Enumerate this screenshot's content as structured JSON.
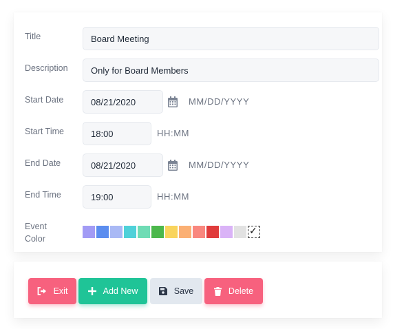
{
  "form": {
    "title": {
      "label": "Title",
      "value": "Board Meeting"
    },
    "description": {
      "label": "Description",
      "value": "Only for Board Members"
    },
    "start_date": {
      "label": "Start Date",
      "value": "08/21/2020",
      "hint": "MM/DD/YYYY",
      "icon": "calendar-icon"
    },
    "start_time": {
      "label": "Start Time",
      "value": "18:00",
      "hint": "HH:MM"
    },
    "end_date": {
      "label": "End Date",
      "value": "08/21/2020",
      "hint": "MM/DD/YYYY",
      "icon": "calendar-icon"
    },
    "end_time": {
      "label": "End Time",
      "value": "19:00",
      "hint": "HH:MM"
    },
    "event_color": {
      "label_line1": "Event",
      "label_line2": "Color",
      "colors": [
        "#a29bf5",
        "#5b8def",
        "#a9b9f5",
        "#4fd1d9",
        "#6fdcb5",
        "#4cb84c",
        "#f9d45c",
        "#fbb074",
        "#f9877e",
        "#e03c3c",
        "#dab3f7",
        "#e2e2e2",
        "#ffffff"
      ],
      "selected_index": 12,
      "selected_mark": "✓"
    }
  },
  "buttons": {
    "exit": {
      "label": "Exit",
      "icon": "sign-out-icon"
    },
    "add_new": {
      "label": "Add New",
      "icon": "plus-icon"
    },
    "save": {
      "label": "Save",
      "icon": "floppy-disk-icon"
    },
    "delete": {
      "label": "Delete",
      "icon": "trash-icon"
    }
  },
  "colors": {
    "danger": "#f7617e",
    "success": "#1fc497",
    "neutral": "#e2e8ef"
  }
}
